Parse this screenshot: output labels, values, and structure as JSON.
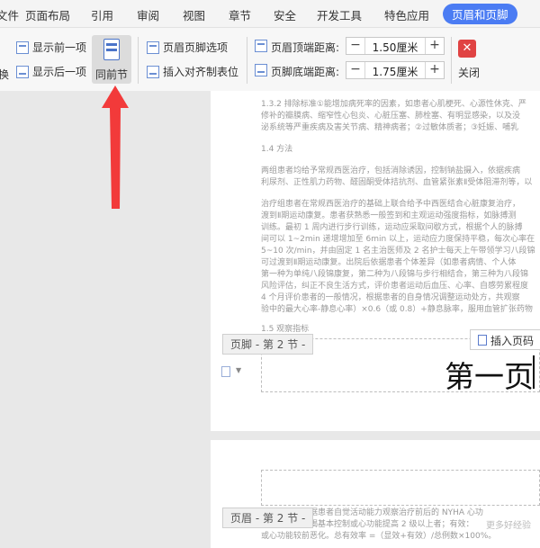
{
  "menu": {
    "items": [
      "文件",
      "页面布局",
      "引用",
      "审阅",
      "视图",
      "章节",
      "安全",
      "开发工具",
      "特色应用"
    ],
    "active": "页眉和页脚"
  },
  "ribbon": {
    "partial_left": "换",
    "show_prev": "显示前一项",
    "show_next": "显示后一项",
    "same_as_prev": "同前节",
    "hf_options": "页眉页脚选项",
    "insert_align_tab": "插入对齐制表位",
    "header_dist_label": "页眉顶端距离:",
    "header_dist_value": "1.50厘米",
    "footer_dist_label": "页脚底端距离:",
    "footer_dist_value": "1.75厘米",
    "minus": "−",
    "plus": "+",
    "close_label": "关闭",
    "close_glyph": "✕"
  },
  "document": {
    "page1_lines": [
      "1.3.2 排除标准①能增加病死率的因素，如患者心肌梗死、心源性休克、严",
      "修补的瓣膜病、缩窄性心包炎、心脏压塞、肺栓塞、有明显感染，以及没",
      "泌系统等严重疾病及害关节病、精神病者；②过敏体质者；③妊娠、哺乳",
      "1.4 方法",
      "两组患者均给予常规西医治疗，包括消除诱因，控制钠盐摄入，依据疾病",
      "利尿剂、正性肌力药物、醛固酮受体拮抗剂、血管紧张素Ⅱ受体阻滞剂等，以",
      "治疗组患者在常规西医治疗的基础上联合给予中西医结合心脏康复治疗，",
      "渡到Ⅱ期运动康复。患者获熟悉一般签到和主观运动强度指标，如脉搏测",
      "训练。最初 1 周内进行步行训练，运动应采取间歇方式，根据个人的脉搏",
      "间可以 1~2min 递增增加至 6min 以上，运动应力度保持平稳，每次心率在",
      "5~10 次/min，并由固定 1 名主治医师及 2 名护士每天上午带领学习八段锦",
      "可过渡到Ⅱ期运动康复。出院后依据患者个体差异（如患者病情、个人体",
      "第一种为单纯八段锦康复，第二种为八段锦与步行相结合，第三种为八段锦",
      "风险评估，纠正不良生活方式，评价患者运动后血压、心率、自感劳累程度",
      "4 个月评价患者的一般情况，根据患者的自身情况调整运动处方，共观察",
      "验中的最大心率-静息心率）×0.6（或 0.8）+静息脉率，服用血管扩张药物",
      "1.5 观察指标"
    ],
    "footer_tag": "页脚 - 第 2 节 -",
    "insert_page_number": "插入页码",
    "footer_text": "第一页",
    "page2_lines": [
      "心功能分级根据患者自觉活动能力观察治疗前后的 NYHA 心功",
      "显效：心力衰竭基本控制或心功能提高 2 级以上者；有效：",
      "或心功能较前恶化。总有效率 =（显效+有效）/总例数×100%。"
    ],
    "header_tag": "页眉 - 第 2 节 -",
    "watermark": "更多好经验"
  }
}
